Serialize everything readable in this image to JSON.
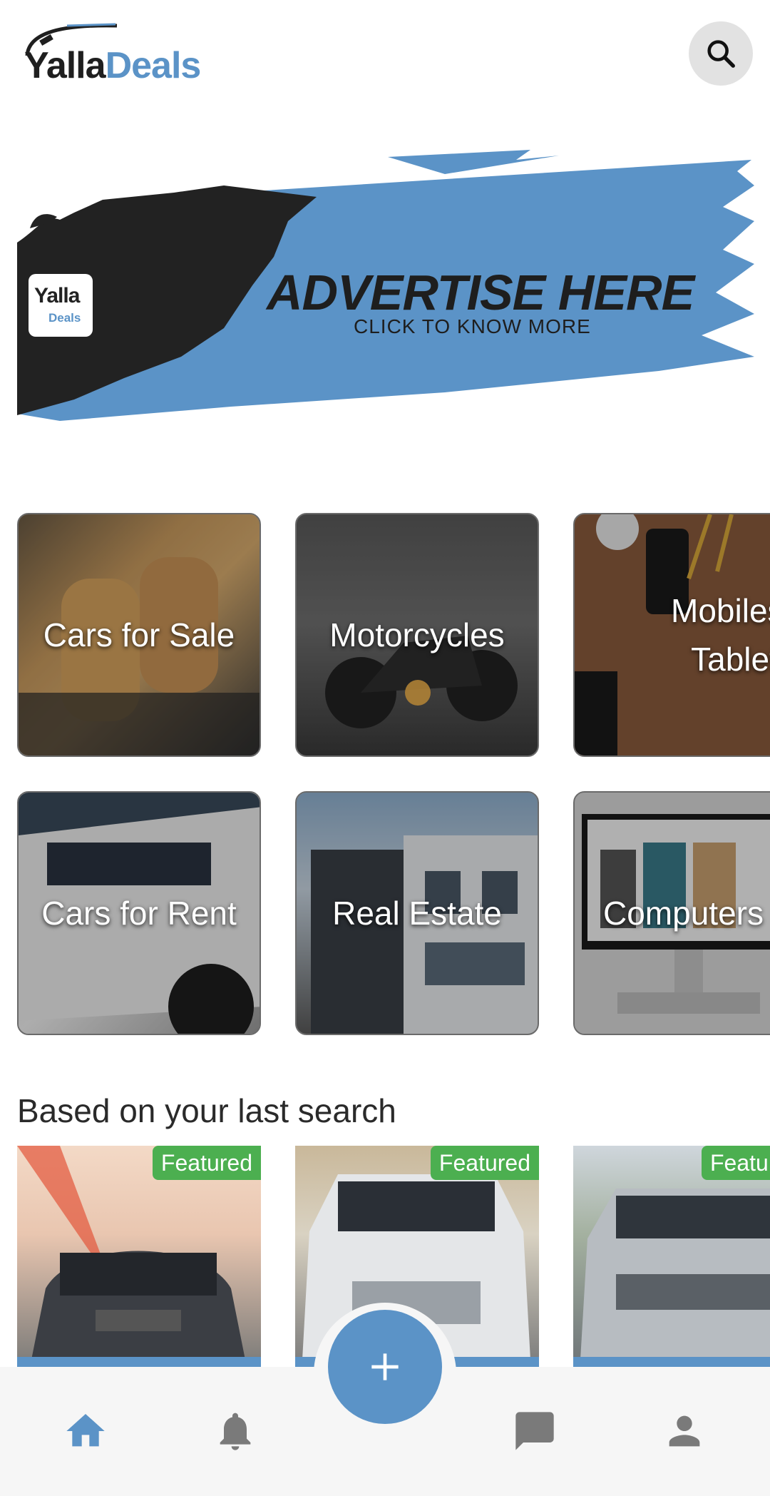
{
  "header": {
    "logo_text_dark": "Yalla",
    "logo_text_accent": "Deals",
    "search_icon": "search-icon"
  },
  "banner": {
    "badge_text_dark": "Yalla",
    "badge_text_accent": "Deals",
    "title": "ADVERTISE HERE",
    "subtitle": "CLICK TO KNOW MORE"
  },
  "categories": [
    {
      "label": "Cars for Sale"
    },
    {
      "label": "Motorcycles"
    },
    {
      "label": "Mobiles & Tablets"
    },
    {
      "label": "Cars for Rent"
    },
    {
      "label": "Real Estate"
    },
    {
      "label": "Computers"
    }
  ],
  "section": {
    "title": "Based on your last search"
  },
  "featured": [
    {
      "badge": "Featured"
    },
    {
      "badge": "Featured"
    },
    {
      "badge": "Featured"
    }
  ],
  "bottom_nav": {
    "items": [
      "home-icon",
      "bell-icon",
      "plus-icon",
      "chat-icon",
      "person-icon"
    ],
    "active": "home-icon"
  },
  "colors": {
    "accent": "#5b93c7",
    "featured": "#4caf50",
    "inactive_icon": "#7a7a7a"
  }
}
